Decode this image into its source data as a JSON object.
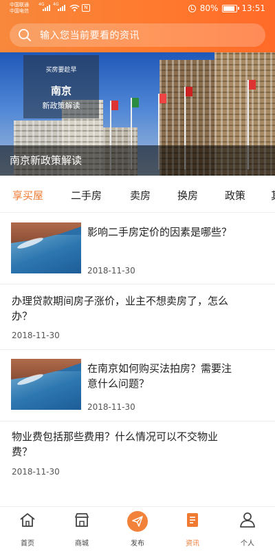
{
  "status_bar": {
    "carrier_1": "中国联通",
    "carrier_2": "中国电信",
    "sig1_label": "4G",
    "sig2_label": "4G",
    "nfc_label": "N",
    "battery": "80%",
    "battery_level": 0.8,
    "time": "13:51"
  },
  "search": {
    "placeholder": "输入您当前要看的资讯"
  },
  "banner": {
    "card_kicker": "买房要趁早",
    "card_city": "南京",
    "card_policy": "新政策解读",
    "caption": "南京新政策解读"
  },
  "tabs": [
    {
      "label": "享买屋",
      "active": true
    },
    {
      "label": "二手房"
    },
    {
      "label": "卖房"
    },
    {
      "label": "换房"
    },
    {
      "label": "政策"
    },
    {
      "label": "其"
    }
  ],
  "articles": [
    {
      "title": "影响二手房定价的因素是哪些？",
      "date": "2018-11-30",
      "has_thumb": true
    },
    {
      "title_line1": "办理贷款期间房子涨价，业主不想卖房了，怎么",
      "title_line2": "办？",
      "date": "2018-11-30",
      "has_thumb": false
    },
    {
      "title_line1": "在南京如何购买法拍房？需要注",
      "title_line2": "意什么问题？",
      "date": "2018-11-30",
      "has_thumb": true
    },
    {
      "title_line1": "物业费包括那些费用？什么情况可以不交物业",
      "title_line2": "费？",
      "date": "2018-11-30",
      "has_thumb": false
    }
  ],
  "bottom_nav": [
    {
      "label": "首页",
      "icon": "home-icon"
    },
    {
      "label": "商城",
      "icon": "store-icon"
    },
    {
      "label": "发布",
      "icon": "send-icon"
    },
    {
      "label": "资讯",
      "icon": "news-icon",
      "active": true
    },
    {
      "label": "个人",
      "icon": "profile-icon"
    }
  ],
  "colors": {
    "accent": "#f07a32",
    "header_start": "#f7883c",
    "header_end": "#ff6a28"
  }
}
